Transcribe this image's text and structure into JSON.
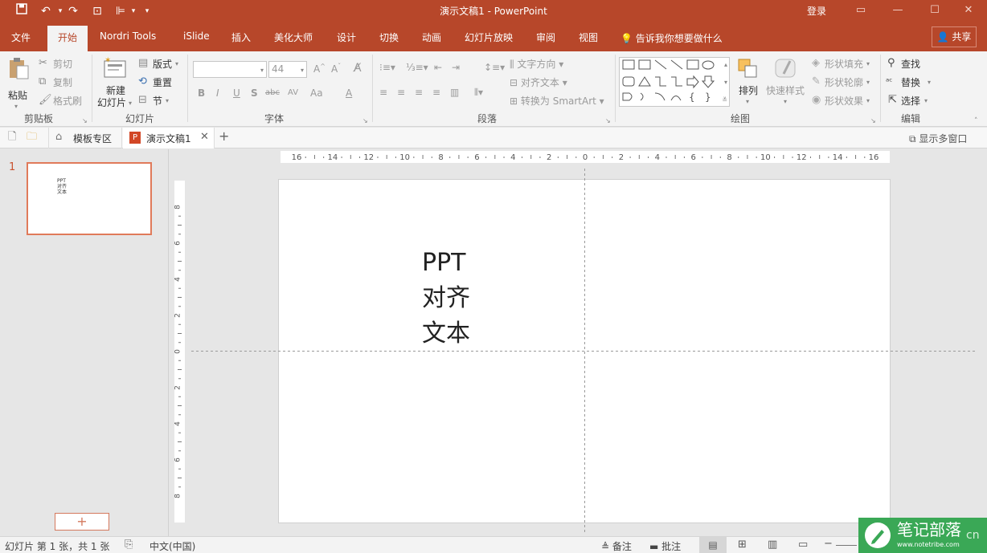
{
  "app": {
    "title": "演示文稿1 - PowerPoint",
    "login": "登录",
    "colors": {
      "brand": "#b7472a",
      "ribbon_bg": "#f3f3f3",
      "workspace": "#e6e6e6",
      "selected_slide_border": "#e07a5a",
      "watermark_bg": "#3aa856"
    }
  },
  "quick_access": {
    "icons": [
      "save-icon",
      "undo-icon",
      "redo-icon",
      "start-slideshow-icon",
      "format-painter-icon",
      "customize-icon"
    ]
  },
  "menu_tabs": [
    "文件",
    "开始",
    "Nordri Tools",
    "iSlide",
    "插入",
    "美化大师",
    "设计",
    "切换",
    "动画",
    "幻灯片放映",
    "审阅",
    "视图"
  ],
  "active_tab": "开始",
  "tell_me": "告诉我你想要做什么",
  "share": "共享",
  "ribbon": {
    "clipboard": {
      "paste": "粘贴",
      "cut": "剪切",
      "copy": "复制",
      "format_painter": "格式刷",
      "label": "剪贴板"
    },
    "slides": {
      "new_slide_1": "新建",
      "new_slide_2": "幻灯片",
      "layout": "版式",
      "reset": "重置",
      "section": "节",
      "label": "幻灯片"
    },
    "font": {
      "font_name": "",
      "font_size": "44",
      "label": "字体",
      "buttons": [
        "B",
        "I",
        "U",
        "S",
        "abc",
        "AV",
        "Aa",
        "A"
      ]
    },
    "paragraph": {
      "text_direction": "文字方向",
      "align_text": "对齐文本",
      "smartart": "转换为 SmartArt",
      "label": "段落"
    },
    "drawing": {
      "arrange": "排列",
      "quick_styles": "快速样式",
      "shape_fill": "形状填充",
      "shape_outline": "形状轮廓",
      "shape_effects": "形状效果",
      "label": "绘图"
    },
    "editing": {
      "find": "查找",
      "replace": "替换",
      "select": "选择",
      "label": "编辑"
    }
  },
  "doc_tabs": {
    "template_zone": "模板专区",
    "current": "演示文稿1",
    "show_windows": "显示多窗口"
  },
  "ruler": {
    "h_labels": [
      "16",
      "14",
      "12",
      "10",
      "8",
      "6",
      "4",
      "2",
      "0",
      "2",
      "4",
      "6",
      "8",
      "10",
      "12",
      "14",
      "16"
    ],
    "v_labels": [
      "8",
      "6",
      "4",
      "2",
      "0",
      "2",
      "4",
      "6",
      "8"
    ]
  },
  "thumbnails": [
    {
      "number": "1",
      "text": [
        "PPT",
        "对齐",
        "文本"
      ]
    }
  ],
  "slide": {
    "lines": [
      "PPT",
      "对齐",
      "文本"
    ]
  },
  "add_slide": "+",
  "status": {
    "slide_info": "幻灯片 第 1 张，共 1 张",
    "language": "中文(中国)",
    "notes": "备注",
    "comments": "批注"
  },
  "watermark": {
    "title": "笔记部落",
    "url": "www.notetribe.com",
    "suffix": "cn"
  }
}
